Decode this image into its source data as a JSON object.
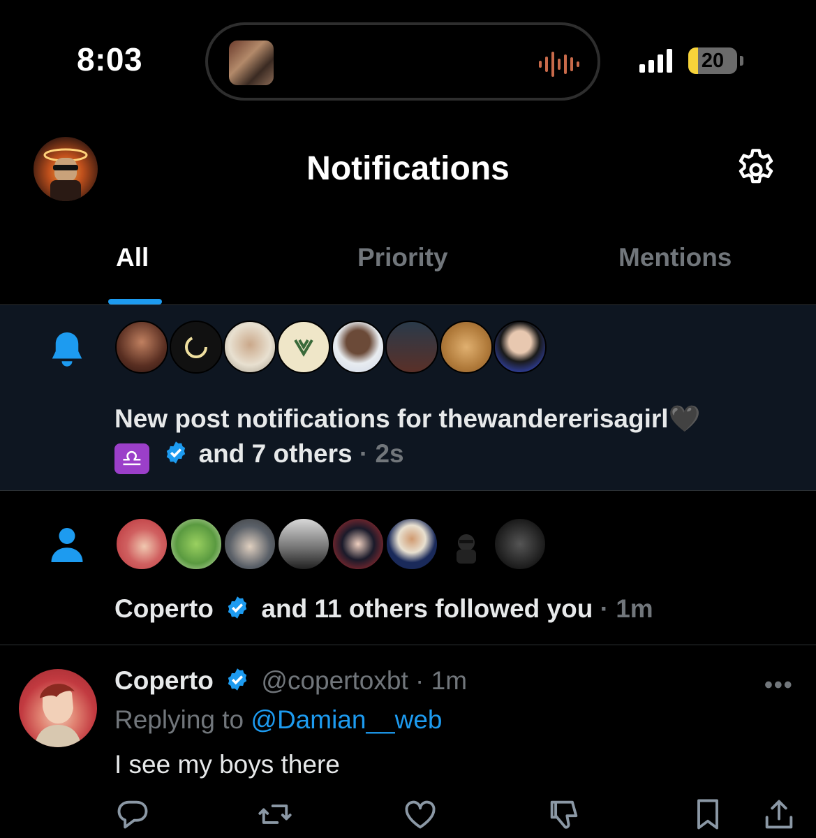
{
  "status_bar": {
    "time": "8:03",
    "battery_percent": "20",
    "battery_level": 0.2
  },
  "header": {
    "title": "Notifications"
  },
  "tabs": [
    {
      "label": "All",
      "active": true
    },
    {
      "label": "Priority",
      "active": false
    },
    {
      "label": "Mentions",
      "active": false
    }
  ],
  "notifications": [
    {
      "type": "new-post",
      "icon": "bell-icon",
      "line1": "New post notifications for thewandererisagirl🖤",
      "line2_text": "and 7 others",
      "separator": "·",
      "time": "2s"
    },
    {
      "type": "follow",
      "icon": "person-icon",
      "name": "Coperto",
      "text": "and 11 others followed you",
      "separator": "·",
      "time": "1m"
    }
  ],
  "reply_post": {
    "name": "Coperto",
    "handle": "@copertoxbt",
    "separator": "·",
    "time": "1m",
    "replying_prefix": "Replying to",
    "replying_to": "@Damian__web",
    "body": "I see my boys there",
    "more": "•••"
  },
  "colors": {
    "accent": "#1d9bf0",
    "background": "#000000",
    "highlight_row": "#0e1621",
    "muted_text": "#71767b"
  }
}
